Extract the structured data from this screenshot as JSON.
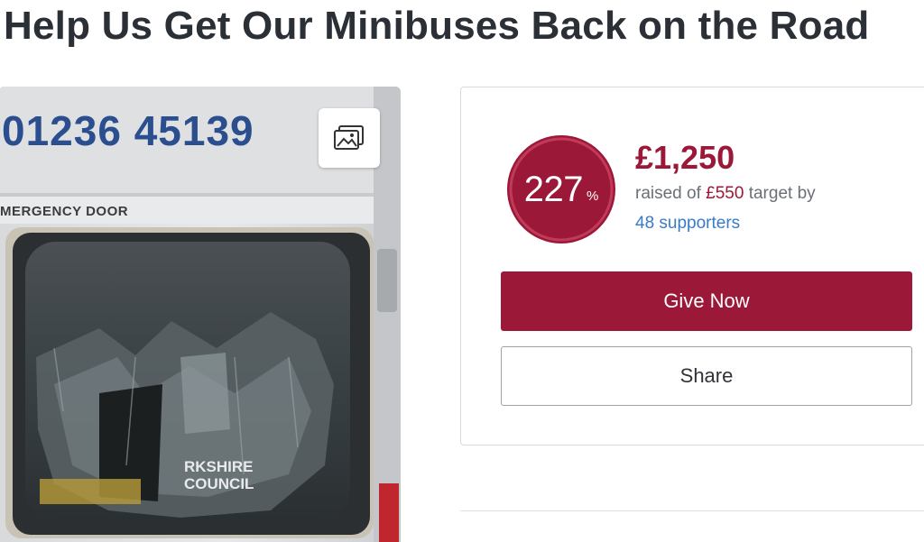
{
  "page": {
    "title": "Help Us Get Our Minibuses Back on the Road"
  },
  "hero": {
    "phone_text": "01236 45139",
    "door_label": "MERGENCY DOOR",
    "council_line1": "RKSHIRE",
    "council_line2": "COUNCIL",
    "gallery_icon": "image-gallery-icon"
  },
  "fundraiser": {
    "percent": "227",
    "percent_sign": "%",
    "percent_value": 227,
    "amount_raised": "£1,250",
    "raised_prefix": "raised of ",
    "target_amount": "£550",
    "raised_suffix": " target by",
    "supporters": "48 supporters",
    "give_label": "Give Now",
    "share_label": "Share"
  },
  "colors": {
    "brand": "#9b1838",
    "link": "#3a7bc8"
  }
}
